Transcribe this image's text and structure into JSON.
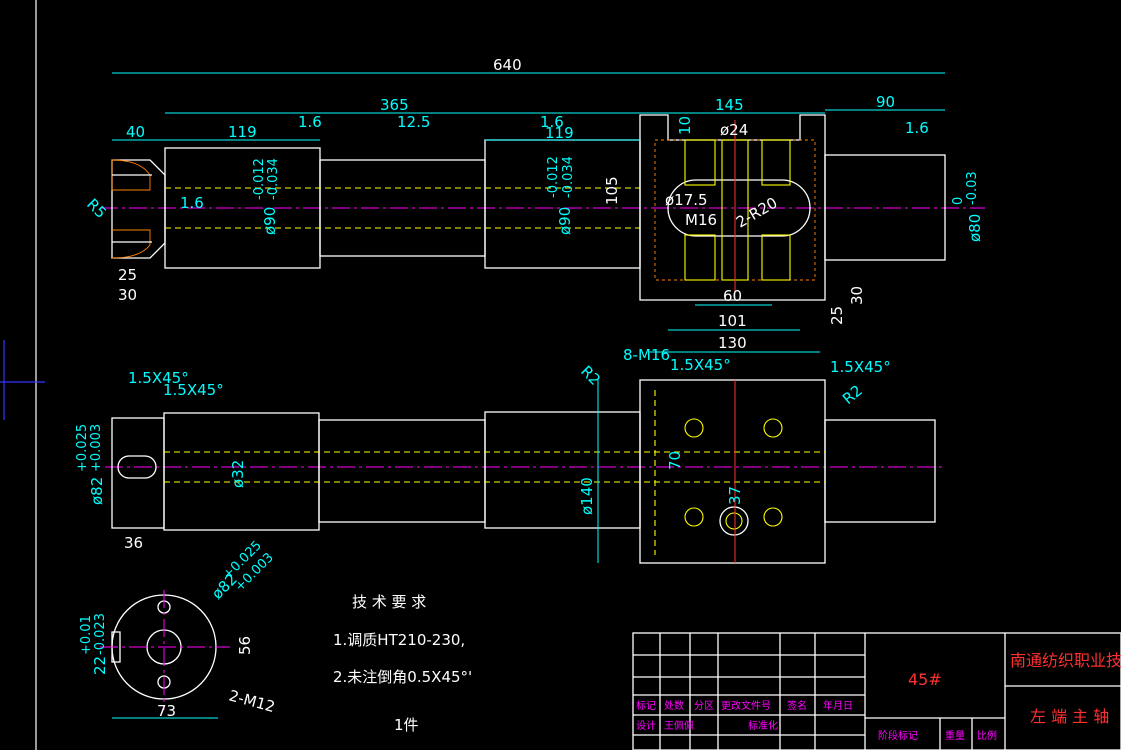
{
  "drawing": {
    "dims": {
      "d640": "640",
      "d365": "365",
      "d145": "145",
      "d90": "90",
      "d40": "40",
      "d119a": "119",
      "d119b": "119",
      "d10": "10",
      "d24": "ø24",
      "d105": "105",
      "d175": "ø17.5",
      "m16": "M16",
      "r20": "2-R20",
      "d60": "60",
      "d101": "101",
      "d130": "130",
      "d25a": "25",
      "d30a": "30",
      "d25b": "25",
      "d30b": "30",
      "r5": "R5",
      "phi90a": "ø90",
      "phi90a_tol_up": "-0.012",
      "phi90a_tol_dn": "-0.034",
      "phi90b": "ø90",
      "phi90b_tol_up": "-0.012",
      "phi90b_tol_dn": "-0.034",
      "phi80": "ø80",
      "phi80_tol_up": "0",
      "phi80_tol_dn": "-0.03",
      "rough_16": "1.6",
      "rough_125": "12.5",
      "m16x8": "8-M16",
      "r2a": "R2",
      "r2b": "R2",
      "chamfer": "1.5X45°",
      "phi82": "ø82",
      "phi82_tol_up": "+0.025",
      "phi82_tol_dn": "+0.003",
      "phi32": "ø32",
      "phi140": "ø140",
      "d70": "70",
      "d37": "37",
      "d36": "36",
      "end_phi82": "ø82",
      "end_phi82_tol_up": "+0.025",
      "end_phi82_tol_dn": "+0.003",
      "d22": "22",
      "d22_tol_up": "+0.01",
      "d22_tol_dn": "-0.023",
      "d56": "56",
      "d73": "73",
      "m12": "2-M12"
    },
    "notes": {
      "title": "技 术 要 求",
      "line1": "1.调质HT210-230,",
      "line2": "2.未注倒角0.5X45°'",
      "qty": "1件"
    },
    "title_block": {
      "material": "45#",
      "school": "南通纺织职业技术学",
      "part_name": "左 端 主 轴",
      "labels": [
        "标记",
        "处数",
        "分区",
        "更改文件号",
        "签名",
        "年月日"
      ],
      "row2": [
        "设计",
        "王佩佩",
        "标准化"
      ],
      "stage": "阶段标记",
      "weight": "重量",
      "scale": "比例"
    },
    "colors": {
      "background": "#000000",
      "outline": "#ffffff",
      "hidden": "#ffff00",
      "dimension": "#00ffff",
      "center": "#ff00ff",
      "section": "#00ff00",
      "title": "#ff3030"
    }
  }
}
